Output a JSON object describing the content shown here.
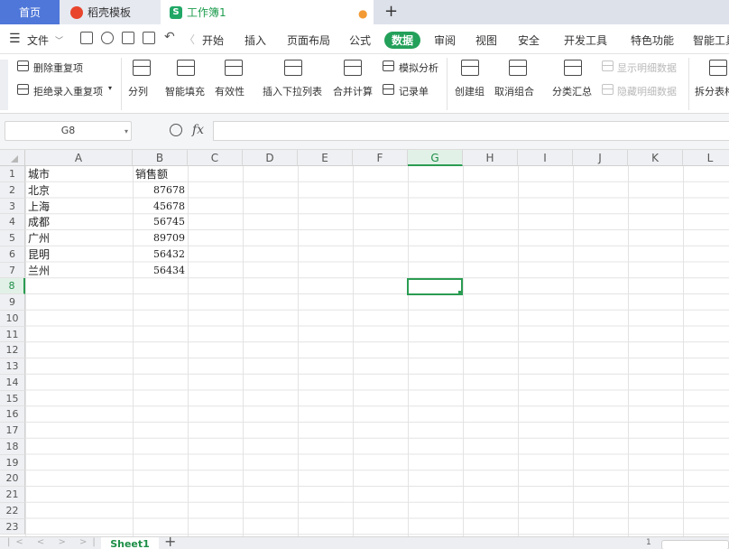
{
  "tabs": {
    "home": "首页",
    "daoke": "稻壳模板",
    "book": "工作簿1",
    "book_logo": "S",
    "add": "+"
  },
  "menu": {
    "file": "文件",
    "items": [
      "开始",
      "插入",
      "页面布局",
      "公式",
      "数据",
      "审阅",
      "视图",
      "安全",
      "开发工具",
      "特色功能",
      "智能工具"
    ],
    "active": "数据",
    "active_color": "#23a05a"
  },
  "ribbon": {
    "remove_duplicates": "删除重复项",
    "reject_duplicates": "拒绝录入重复项",
    "split_column": "分列",
    "smart_fill": "智能填充",
    "validity": "有效性",
    "insert_dropdown": "插入下拉列表",
    "merge_calc": "合并计算",
    "simulation": "模拟分析",
    "record_form": "记录单",
    "create_group": "创建组",
    "ungroup": "取消组合",
    "subtotal": "分类汇总",
    "show_detail": "显示明细数据",
    "hide_detail": "隐藏明细数据",
    "split_table": "拆分表格"
  },
  "formula": {
    "name_box": "G8",
    "fx_label": "fx",
    "value": ""
  },
  "grid": {
    "columns": [
      "A",
      "B",
      "C",
      "D",
      "E",
      "F",
      "G",
      "H",
      "I",
      "J",
      "K",
      "L"
    ],
    "rows": [
      "1",
      "2",
      "3",
      "4",
      "5",
      "6",
      "7",
      "8",
      "9",
      "10",
      "11",
      "12",
      "13",
      "14",
      "15",
      "16",
      "17",
      "18",
      "19",
      "20",
      "21",
      "22",
      "23"
    ],
    "selected_col": "G",
    "selected_row": "8",
    "header_city": "城市",
    "header_sales": "销售额",
    "data": [
      {
        "city": "北京",
        "sales": "87678"
      },
      {
        "city": "上海",
        "sales": "45678"
      },
      {
        "city": "成都",
        "sales": "56745"
      },
      {
        "city": "广州",
        "sales": "89709"
      },
      {
        "city": "昆明",
        "sales": "56432"
      },
      {
        "city": "兰州",
        "sales": "56434"
      }
    ]
  },
  "sheetbar": {
    "sheet_name": "Sheet1",
    "add_label": "+",
    "page": "1"
  }
}
